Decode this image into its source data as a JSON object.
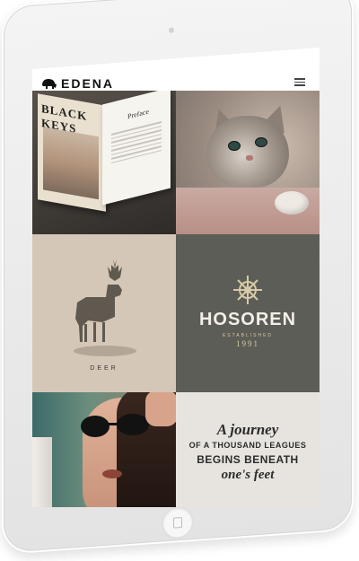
{
  "site": {
    "brand": "EDENA",
    "logo_icon": "elephant-icon",
    "menu_icon": "hamburger-menu-icon"
  },
  "tiles": [
    {
      "name": "book-tile",
      "book_title": "BLACK KEYS",
      "page_heading": "Preface"
    },
    {
      "name": "kitten-tile"
    },
    {
      "name": "deer-tile",
      "label": "DEER"
    },
    {
      "name": "hosoren-tile",
      "brand": "HOSOREN",
      "tagline": "ESTABLISHED",
      "year": "1991"
    },
    {
      "name": "woman-tile"
    },
    {
      "name": "quote-tile",
      "lines": [
        "A journey",
        "OF A THOUSAND LEAGUES",
        "BEGINS BENEATH",
        "one's feet"
      ]
    }
  ],
  "colors": {
    "tile_deer_bg": "#d4c7b8",
    "tile_hosoren_bg": "#5c5d56",
    "tile_quote_bg": "#e7e4df",
    "accent_gold": "#d8c9a6"
  }
}
